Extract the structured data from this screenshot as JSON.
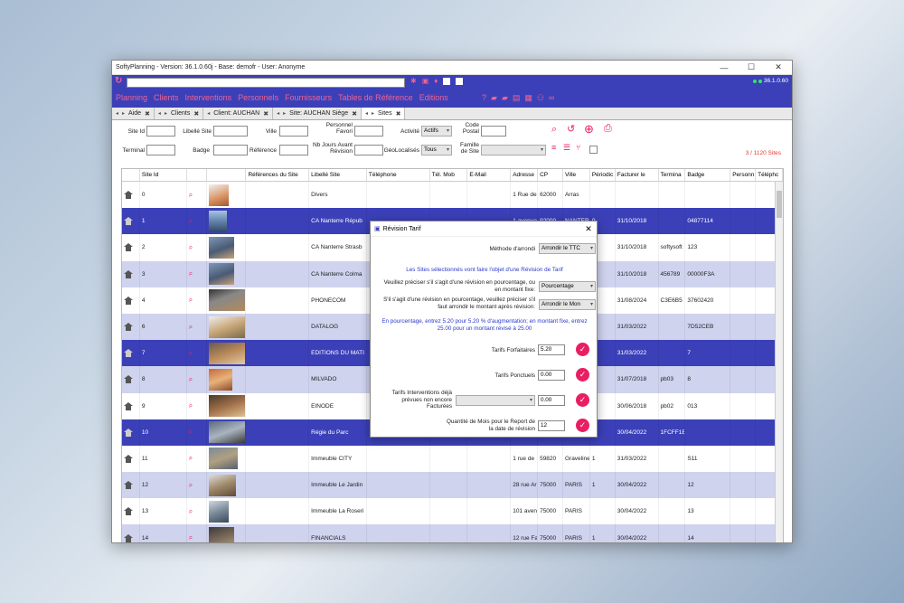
{
  "window": {
    "title": "SoftyPlanning - Version: 36.1.0.60j - Base: demofr - User: Anonyme",
    "version_badge": "36.1.0.60"
  },
  "menu": [
    "Planning",
    "Clients",
    "Interventions",
    "Personnels",
    "Fournisseurs",
    "Tables de Référence",
    "Editions"
  ],
  "tabs": [
    {
      "label": "Aide"
    },
    {
      "label": "Clients"
    },
    {
      "label": "Client: AUCHAN"
    },
    {
      "label": "Site: AUCHAN Siège"
    },
    {
      "label": "Sites"
    }
  ],
  "filters": {
    "site_id": "Site Id",
    "libelle_site": "Libellé Site",
    "ville": "Ville",
    "personnel_favori": "Personnel Favori",
    "activite": "Activité",
    "activite_value": "Actifs",
    "code_postal": "Code Postal",
    "terminal": "Terminal",
    "badge": "Badge",
    "reference": "Référence",
    "nb_jours": "Nb Jours Avant Révision",
    "geolocalises": "GéoLocalisés",
    "geolocalises_value": "Tous",
    "famille_site": "Famille de Site",
    "count": "3 / 1120 Sites"
  },
  "columns": [
    "Site Id",
    "Références du Site",
    "Libellé Site",
    "Téléphone",
    "Tél. Mob",
    "E-Mail",
    "Adresse",
    "CP",
    "Ville",
    "Périodic",
    "Facturer le",
    "Termina",
    "Badge",
    "Personn",
    "Téléphc"
  ],
  "rows": [
    {
      "id": "0",
      "libelle": "Divers",
      "adresse": "1 Rue de",
      "cp": "62000",
      "ville": "Arras",
      "period": "",
      "facturer": "",
      "terminal": "",
      "badge": "",
      "style": "r0"
    },
    {
      "id": "1",
      "libelle": "CA Nanterre Répub",
      "adresse": "1 avenue",
      "cp": "92000",
      "ville": "NANTERR",
      "period": "0",
      "facturer": "31/10/2018",
      "terminal": "",
      "badge": "04877114",
      "style": "r2"
    },
    {
      "id": "2",
      "libelle": "CA Nanterre Strasb",
      "adresse": "",
      "cp": "",
      "ville": "",
      "period": "",
      "facturer": "31/10/2018",
      "terminal": "softysoft",
      "badge": "123",
      "style": "r0"
    },
    {
      "id": "3",
      "libelle": "CA Nanterre Colma",
      "adresse": "",
      "cp": "",
      "ville": "",
      "period": "",
      "facturer": "31/10/2018",
      "terminal": "456789",
      "badge": "00000F3A",
      "style": "r1"
    },
    {
      "id": "4",
      "libelle": "PHONECOM",
      "adresse": "",
      "cp": "",
      "ville": "",
      "period": "",
      "facturer": "31/08/2024",
      "terminal": "C3E6B5",
      "badge": "37602420",
      "style": "r0"
    },
    {
      "id": "6",
      "libelle": "DATALOG",
      "adresse": "",
      "cp": "",
      "ville": "",
      "period": "",
      "facturer": "31/03/2022",
      "terminal": "",
      "badge": "7D52CEB",
      "style": "r1"
    },
    {
      "id": "7",
      "libelle": "EDITIONS DU MATI",
      "adresse": "",
      "cp": "",
      "ville": "",
      "period": "",
      "facturer": "31/03/2022",
      "terminal": "",
      "badge": "7",
      "style": "r2"
    },
    {
      "id": "8",
      "libelle": "MILVADO",
      "adresse": "",
      "cp": "",
      "ville": "",
      "period": "",
      "facturer": "31/07/2018",
      "terminal": "pb03",
      "badge": "8",
      "style": "r1"
    },
    {
      "id": "9",
      "libelle": "EINODE",
      "adresse": "",
      "cp": "",
      "ville": "",
      "period": "",
      "facturer": "30/06/2018",
      "terminal": "pb02",
      "badge": "013",
      "style": "r0"
    },
    {
      "id": "10",
      "libelle": "Régie du Parc",
      "adresse": "",
      "cp": "",
      "ville": "",
      "period": "",
      "facturer": "30/04/2022",
      "terminal": "1FCFF1E",
      "badge": "",
      "style": "r2"
    },
    {
      "id": "11",
      "libelle": "Immeuble CITY",
      "adresse": "1 rue de",
      "cp": "59820",
      "ville": "Graveline",
      "period": "1",
      "facturer": "31/03/2022",
      "terminal": "",
      "badge": "S11",
      "style": "r0"
    },
    {
      "id": "12",
      "libelle": "Immeuble Le Jardin",
      "adresse": "28 rue Ar",
      "cp": "75000",
      "ville": "PARIS",
      "period": "1",
      "facturer": "30/04/2022",
      "terminal": "",
      "badge": "12",
      "style": "r1"
    },
    {
      "id": "13",
      "libelle": "Immeuble La Roseri",
      "adresse": "101 aven",
      "cp": "75000",
      "ville": "PARIS",
      "period": "",
      "facturer": "30/04/2022",
      "terminal": "",
      "badge": "13",
      "style": "r0"
    },
    {
      "id": "14",
      "libelle": "FINANCIALS",
      "adresse": "12 rue Fa",
      "cp": "75000",
      "ville": "PARIS",
      "period": "1",
      "facturer": "30/04/2022",
      "terminal": "",
      "badge": "14",
      "style": "r1"
    }
  ],
  "modal": {
    "title": "Révision Tarif",
    "methode_label": "Méthode d'arrondi",
    "methode_value": "Arrondir le TTC",
    "info1": "Les Sites sélectionnés vont faire l'objet d'une Révision de Tarif",
    "precisez_label": "Veuillez préciser s'il s'agit d'une révision en pourcentage, ou en montant fixe:",
    "precisez_value": "Pourcentage",
    "arrondir_label": "S'il s'agit d'une révision en pourcentage, veuillez préciser s'il faut arrondir le montant après révision:",
    "arrondir_value": "Arrondir le Mon",
    "info2": "En pourcentage, entrez 5.20 pour 5.20 % d'augmentation; en montant fixe, entrez 25.00 pour un montant révisé à 25.00",
    "forfaitaires_label": "Tarifs Forfaitaires",
    "forfaitaires_value": "5.20",
    "ponctuels_label": "Tarifs Ponctuels",
    "ponctuels_value": "0.00",
    "interventions_label": "Tarifs Interventions déjà prévues non encore Facturées",
    "interventions_value": "0.00",
    "mois_label": "Quantité de Mois pour le Report de la date de révision",
    "mois_value": "12"
  }
}
